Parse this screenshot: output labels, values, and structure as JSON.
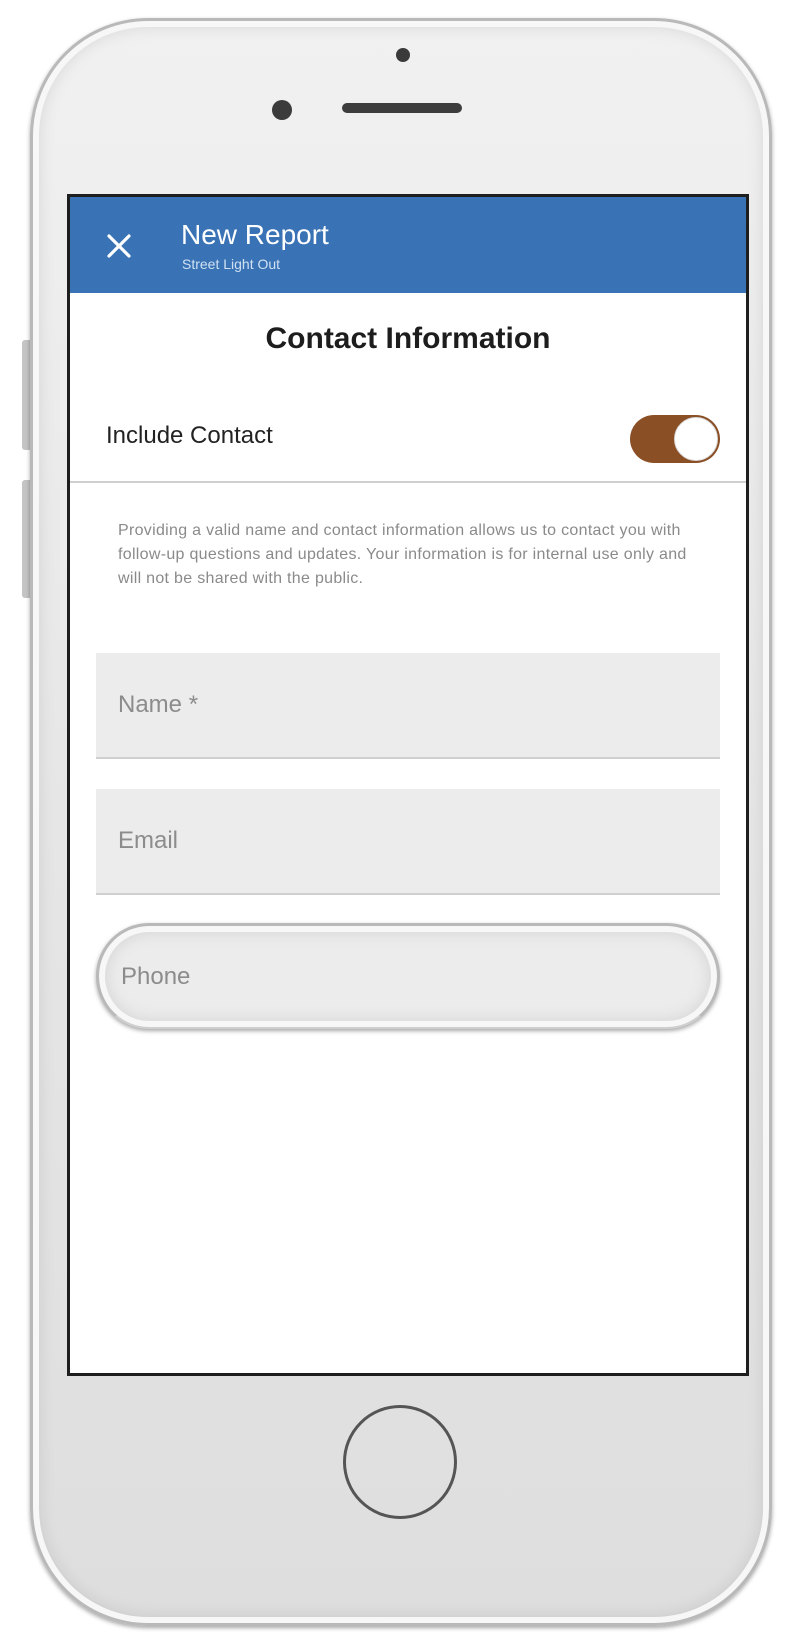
{
  "header": {
    "title": "New Report",
    "subtitle": "Street Light Out",
    "close_icon": "close-icon"
  },
  "section": {
    "title": "Contact Information"
  },
  "include_contact": {
    "label": "Include Contact",
    "enabled": true,
    "toggle_color": "#8b4f25"
  },
  "info": {
    "text": "Providing a valid name and contact information allows us to contact you with follow-up questions and updates. Your information is for internal use only and will not be shared with the public."
  },
  "form": {
    "name": {
      "placeholder": "Name *",
      "value": ""
    },
    "email": {
      "placeholder": "Email",
      "value": ""
    },
    "phone": {
      "placeholder": "Phone",
      "value": ""
    }
  },
  "colors": {
    "header_bg": "#3a73b5",
    "field_bg": "#ececec"
  }
}
